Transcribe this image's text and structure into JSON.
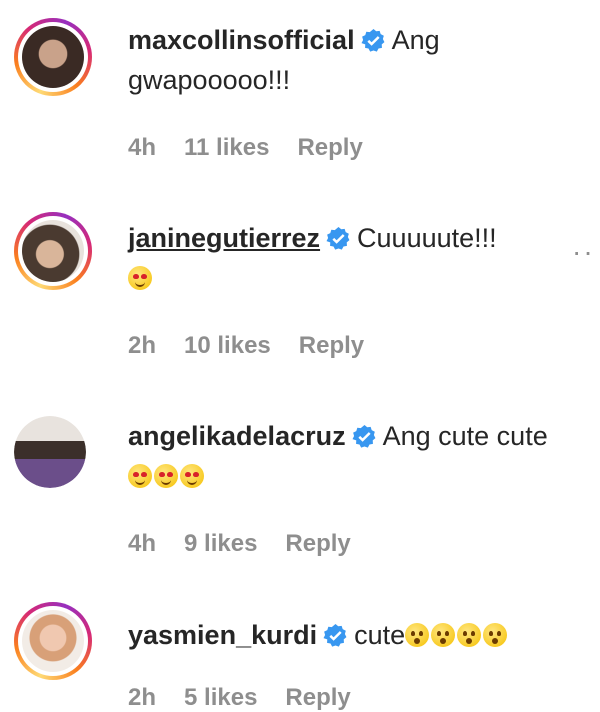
{
  "comments": [
    {
      "username": "maxcollinsofficial",
      "text": "Ang gwapooooo!!!",
      "time": "4h",
      "likes": "11 likes",
      "reply": "Reply"
    },
    {
      "username": "janinegutierrez",
      "text": "Cuuuuute!!!",
      "time": "2h",
      "likes": "10 likes",
      "reply": "Reply",
      "more": "··"
    },
    {
      "username": "angelikadelacruz",
      "text": "Ang cute cute",
      "time": "4h",
      "likes": "9 likes",
      "reply": "Reply"
    },
    {
      "username": "yasmien_kurdi",
      "text": "cute",
      "time": "2h",
      "likes": "5 likes",
      "reply": "Reply"
    }
  ],
  "colors": {
    "verified": "#3897f0",
    "meta": "#8e8e8e",
    "text": "#262626"
  },
  "icons": [
    "verified-badge-icon",
    "heart-eyes-emoji-icon",
    "surprised-emoji-icon",
    "more-options-icon"
  ]
}
